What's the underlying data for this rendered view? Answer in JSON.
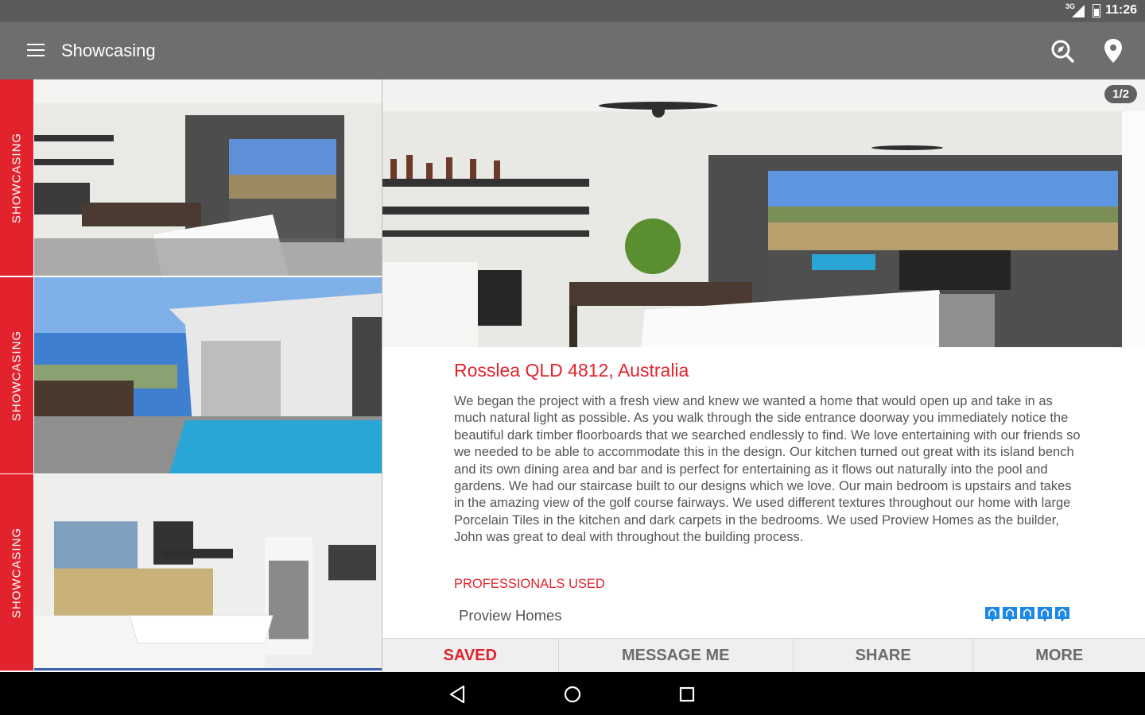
{
  "status_bar": {
    "network": "3G",
    "time": "11:26"
  },
  "app_bar": {
    "title": "Showcasing",
    "menu_icon": "hamburger-menu-icon",
    "search_icon": "search-icon",
    "map_icon": "location-pin-icon"
  },
  "list": {
    "items": [
      {
        "tag": "SHOWCASING",
        "image": "indoor-outdoor kitchen and dining"
      },
      {
        "tag": "SHOWCASING",
        "image": "backyard pool and patio"
      },
      {
        "tag": "SHOWCASING",
        "image": "white kitchen with island bench"
      }
    ]
  },
  "detail": {
    "pager": "1/2",
    "location": "Rosslea QLD 4812, Australia",
    "description": "We began the project with a fresh view and knew we wanted a home that would open up and take in as much natural light as possible. As you walk through the side entrance doorway you immediately notice the beautiful dark timber floorboards that we searched endlessly to find. We love entertaining with our friends so we needed to be able to accommodate this in the design. Our kitchen turned out great with its island bench and its own dining area and bar and is perfect for entertaining as it flows out naturally into the pool and gardens. We had our staircase built to our designs which we love. Our main bedroom is upstairs and takes in the amazing view of the golf course fairways. We used different textures throughout our home with large Porcelain Tiles in the kitchen and dark carpets in the bedrooms. We used Proview Homes as the builder, John was great to deal with throughout the building process.",
    "professionals_heading": "PROFESSIONALS USED",
    "professional_name": "Proview Homes",
    "rating": 5
  },
  "actions": {
    "saved": "SAVED",
    "message": "MESSAGE ME",
    "share": "SHARE",
    "more": "MORE"
  },
  "colors": {
    "accent": "#e2232e",
    "app_bar": "#6e6e6e",
    "status_bar": "#5b5b5b",
    "rating_blue": "#1e88e5"
  }
}
